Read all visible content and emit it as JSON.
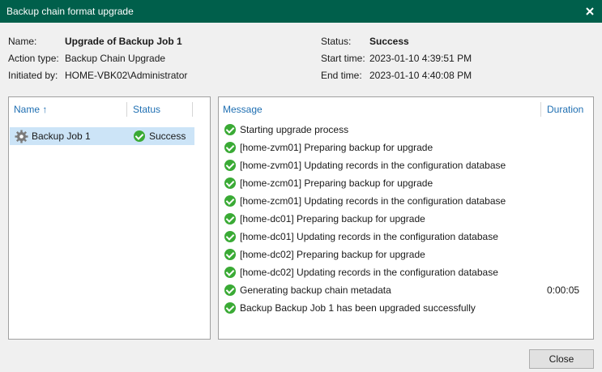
{
  "window": {
    "title": "Backup chain format upgrade"
  },
  "info": {
    "name_label": "Name:",
    "name_value": "Upgrade of Backup Job 1",
    "action_label": "Action type:",
    "action_value": "Backup Chain Upgrade",
    "initiated_label": "Initiated by:",
    "initiated_value": "HOME-VBK02\\Administrator",
    "status_label": "Status:",
    "status_value": "Success",
    "start_label": "Start time:",
    "start_value": "2023-01-10 4:39:51 PM",
    "end_label": "End time:",
    "end_value": "2023-01-10 4:40:08 PM"
  },
  "jobs_table": {
    "col_name": "Name",
    "col_status": "Status",
    "rows": [
      {
        "name": "Backup Job 1",
        "status": "Success",
        "icon": "gear-icon"
      }
    ]
  },
  "messages_table": {
    "col_message": "Message",
    "col_duration": "Duration",
    "rows": [
      {
        "text": "Starting upgrade process",
        "duration": ""
      },
      {
        "text": "[home-zvm01] Preparing backup for upgrade",
        "duration": ""
      },
      {
        "text": "[home-zvm01] Updating records in the configuration database",
        "duration": ""
      },
      {
        "text": "[home-zcm01] Preparing backup for upgrade",
        "duration": ""
      },
      {
        "text": "[home-zcm01] Updating records in the configuration database",
        "duration": ""
      },
      {
        "text": "[home-dc01] Preparing backup for upgrade",
        "duration": ""
      },
      {
        "text": "[home-dc01] Updating records in the configuration database",
        "duration": ""
      },
      {
        "text": "[home-dc02] Preparing backup for upgrade",
        "duration": ""
      },
      {
        "text": "[home-dc02] Updating records in the configuration database",
        "duration": ""
      },
      {
        "text": "Generating backup chain metadata",
        "duration": "0:00:05"
      },
      {
        "text": "Backup Backup Job 1 has been upgraded successfully",
        "duration": ""
      }
    ]
  },
  "buttons": {
    "close": "Close"
  },
  "colors": {
    "titlebar": "#005f4b",
    "header_link": "#1f6fb2",
    "success": "#3aaa35",
    "selection": "#cce4f7"
  }
}
